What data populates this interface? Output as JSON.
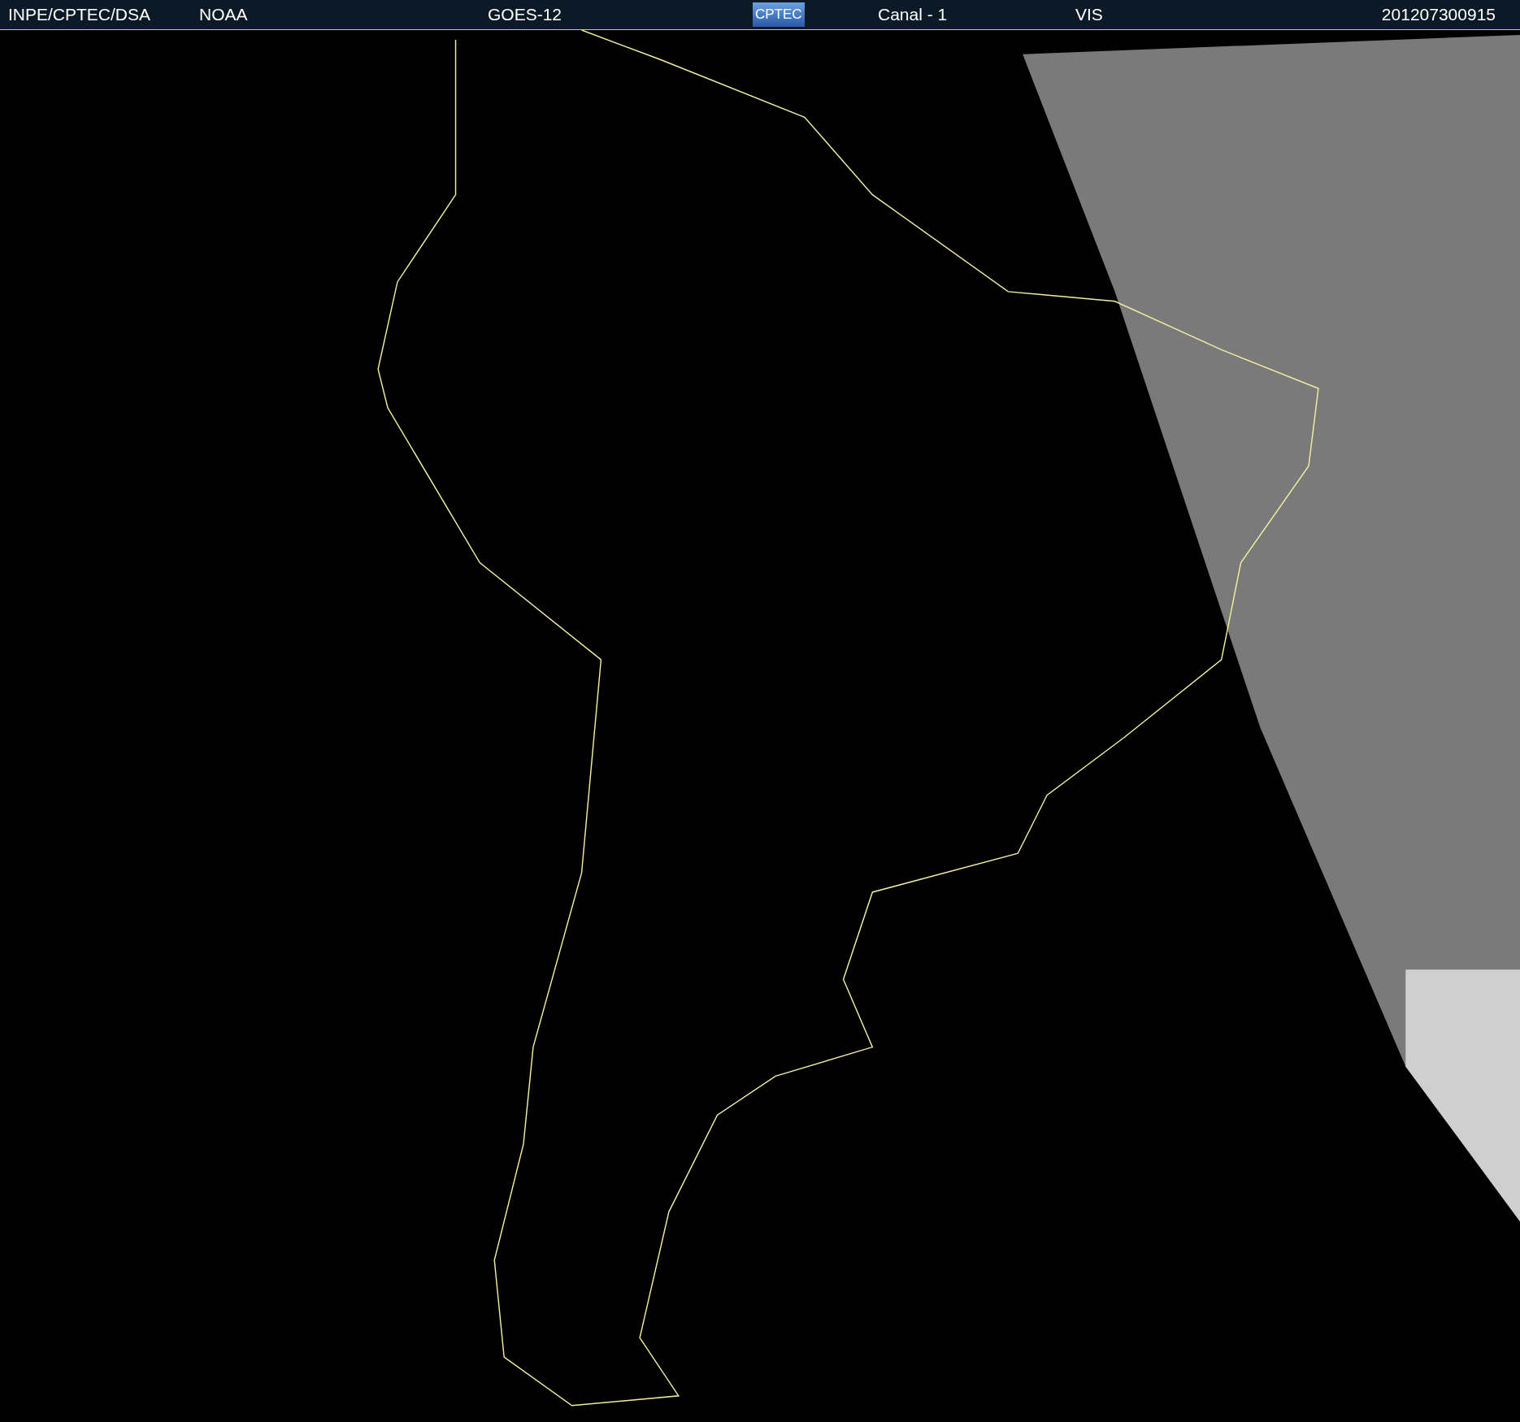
{
  "header": {
    "items": [
      {
        "kind": "text",
        "text": "INPE/CPTEC/DSA"
      },
      {
        "kind": "text",
        "text": "NOAA"
      },
      {
        "kind": "text",
        "text": "GOES-12"
      },
      {
        "kind": "logo",
        "text": "CPTEC"
      },
      {
        "kind": "text",
        "text": "Canal - 1"
      },
      {
        "kind": "text",
        "text": "VIS"
      },
      {
        "kind": "text",
        "text": "201207300915"
      }
    ]
  }
}
